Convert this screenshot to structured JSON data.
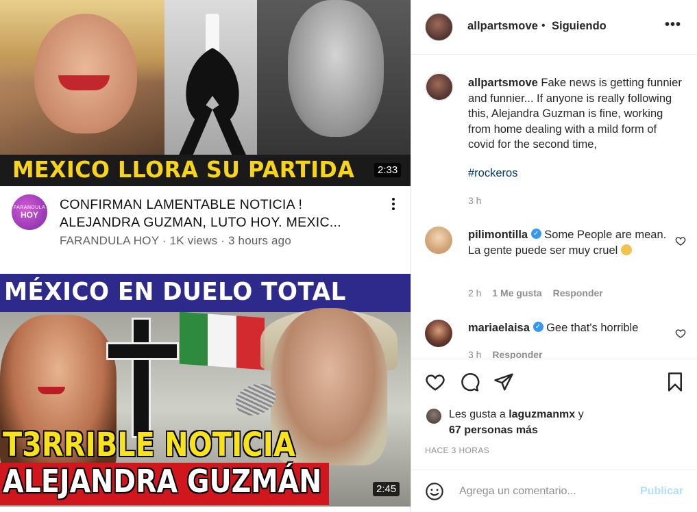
{
  "video1": {
    "banner_text": "MEXICO LLORA SU PARTIDA",
    "duration": "2:33",
    "channel_avatar_top": "FARANDULA",
    "channel_avatar_bottom": "HOY",
    "title_line1": "CONFIRMAN LAMENTABLE NOTICIA !",
    "title_line2": "ALEJANDRA GUZMAN, LUTO HOY. MEXIC...",
    "subtitle": "FARANDULA HOY · 1K views · 3 hours ago",
    "menu_glyph": "⋮"
  },
  "video2": {
    "top_banner": "MÉXICO EN DUELO TOTAL",
    "line1": "T3RRIBLE NOTICIA",
    "line2": "ALEJANDRA GUZMÁN",
    "duration": "2:45",
    "flag_colors": [
      "#2e8b3e",
      "#f4f4f4",
      "#d22a2f"
    ]
  },
  "post": {
    "username": "allpartsmove",
    "separator": "•",
    "follow_status": "Siguiendo",
    "more_glyph": "•••",
    "caption_user": "allpartsmove",
    "caption_text": "Fake news is getting funnier and funnier... If anyone is really following this, Alejandra Guzman is fine, working from home dealing with a mild form of covid for the second time,",
    "hashtag": "#rockeros",
    "caption_time": "3 h",
    "comments": [
      {
        "user": "pilimontilla",
        "verified": true,
        "text": "Some People are mean. La gente puede ser muy cruel",
        "time": "2 h",
        "likes": "1 Me gusta",
        "reply": "Responder"
      },
      {
        "user": "mariaelaisa",
        "verified": true,
        "text": "Gee that's horrible",
        "time": "3 h",
        "reply": "Responder"
      }
    ],
    "likes_prefix": "Les gusta a",
    "likes_user": "laguzmanmx",
    "likes_conj": "y",
    "likes_others": "67 personas más",
    "posted_time": "HACE 3 HORAS",
    "comment_placeholder": "Agrega un comentario...",
    "publish_label": "Publicar",
    "accent_color": "#0095f6",
    "link_color": "#00376b"
  }
}
